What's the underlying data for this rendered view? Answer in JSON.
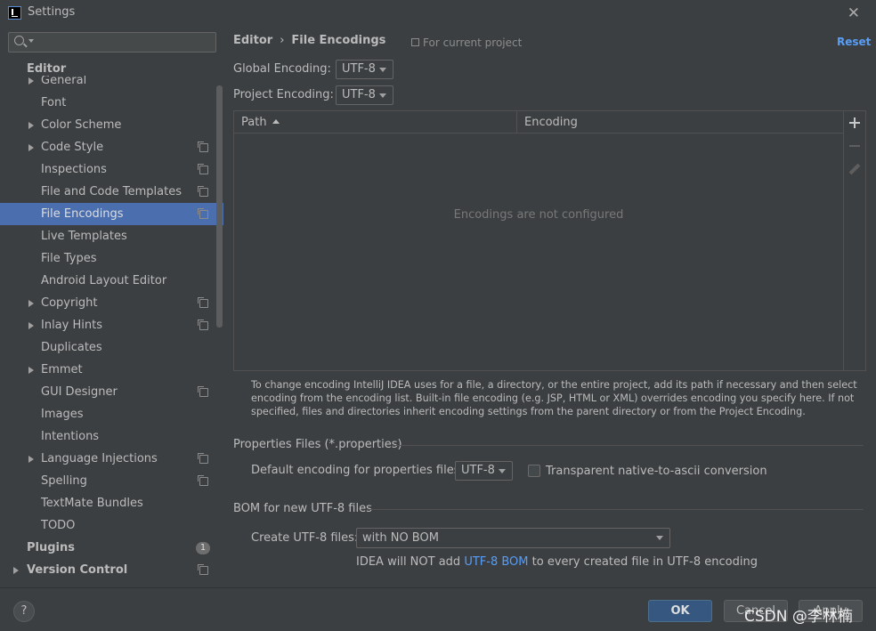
{
  "window": {
    "title": "Settings"
  },
  "sidebar": {
    "search_placeholder": "",
    "section": "Editor",
    "items": [
      {
        "label": "General",
        "expandable": true,
        "project": false
      },
      {
        "label": "Font",
        "expandable": false,
        "project": false
      },
      {
        "label": "Color Scheme",
        "expandable": true,
        "project": false
      },
      {
        "label": "Code Style",
        "expandable": true,
        "project": true
      },
      {
        "label": "Inspections",
        "expandable": false,
        "project": true
      },
      {
        "label": "File and Code Templates",
        "expandable": false,
        "project": true
      },
      {
        "label": "File Encodings",
        "expandable": false,
        "project": true,
        "selected": true
      },
      {
        "label": "Live Templates",
        "expandable": false,
        "project": false
      },
      {
        "label": "File Types",
        "expandable": false,
        "project": false
      },
      {
        "label": "Android Layout Editor",
        "expandable": false,
        "project": false
      },
      {
        "label": "Copyright",
        "expandable": true,
        "project": true
      },
      {
        "label": "Inlay Hints",
        "expandable": true,
        "project": true
      },
      {
        "label": "Duplicates",
        "expandable": false,
        "project": false
      },
      {
        "label": "Emmet",
        "expandable": true,
        "project": false
      },
      {
        "label": "GUI Designer",
        "expandable": false,
        "project": true
      },
      {
        "label": "Images",
        "expandable": false,
        "project": false
      },
      {
        "label": "Intentions",
        "expandable": false,
        "project": false
      },
      {
        "label": "Language Injections",
        "expandable": true,
        "project": true
      },
      {
        "label": "Spelling",
        "expandable": false,
        "project": true
      },
      {
        "label": "TextMate Bundles",
        "expandable": false,
        "project": false
      },
      {
        "label": "TODO",
        "expandable": false,
        "project": false
      }
    ],
    "plugins": {
      "label": "Plugins",
      "badge": "1"
    },
    "version_control": {
      "label": "Version Control"
    }
  },
  "header": {
    "crumb_parent": "Editor",
    "crumb_sep": "›",
    "crumb_current": "File Encodings",
    "scope_note": "For current project",
    "reset_label": "Reset"
  },
  "encodings": {
    "global_label": "Global Encoding:",
    "global_value": "UTF-8",
    "project_label": "Project Encoding:",
    "project_value": "UTF-8"
  },
  "table": {
    "col_path": "Path",
    "col_encoding": "Encoding",
    "empty_text": "Encodings are not configured"
  },
  "help_text": "To change encoding IntelliJ IDEA uses for a file, a directory, or the entire project, add its path if necessary and then select encoding from the encoding list. Built-in file encoding (e.g. JSP, HTML or XML) overrides encoding you specify here. If not specified, files and directories inherit encoding settings from the parent directory or from the Project Encoding.",
  "properties": {
    "title": "Properties Files (*.properties)",
    "default_label": "Default encoding for properties files:",
    "default_value": "UTF-8",
    "transparent_label": "Transparent native-to-ascii conversion",
    "transparent_checked": false
  },
  "bom": {
    "title": "BOM for new UTF-8 files",
    "create_label": "Create UTF-8 files:",
    "create_value": "with NO BOM",
    "note_prefix": "IDEA will NOT add ",
    "note_link": "UTF-8 BOM",
    "note_suffix": " to every created file in UTF-8 encoding"
  },
  "footer": {
    "help_label": "?",
    "ok_label": "OK",
    "cancel_label": "Cancel",
    "apply_label": "Apply"
  },
  "watermark": "CSDN @李林楠",
  "colors": {
    "background": "#3c3f41",
    "selection": "#4b6eaf",
    "link": "#589df6",
    "primary_button": "#365880"
  }
}
